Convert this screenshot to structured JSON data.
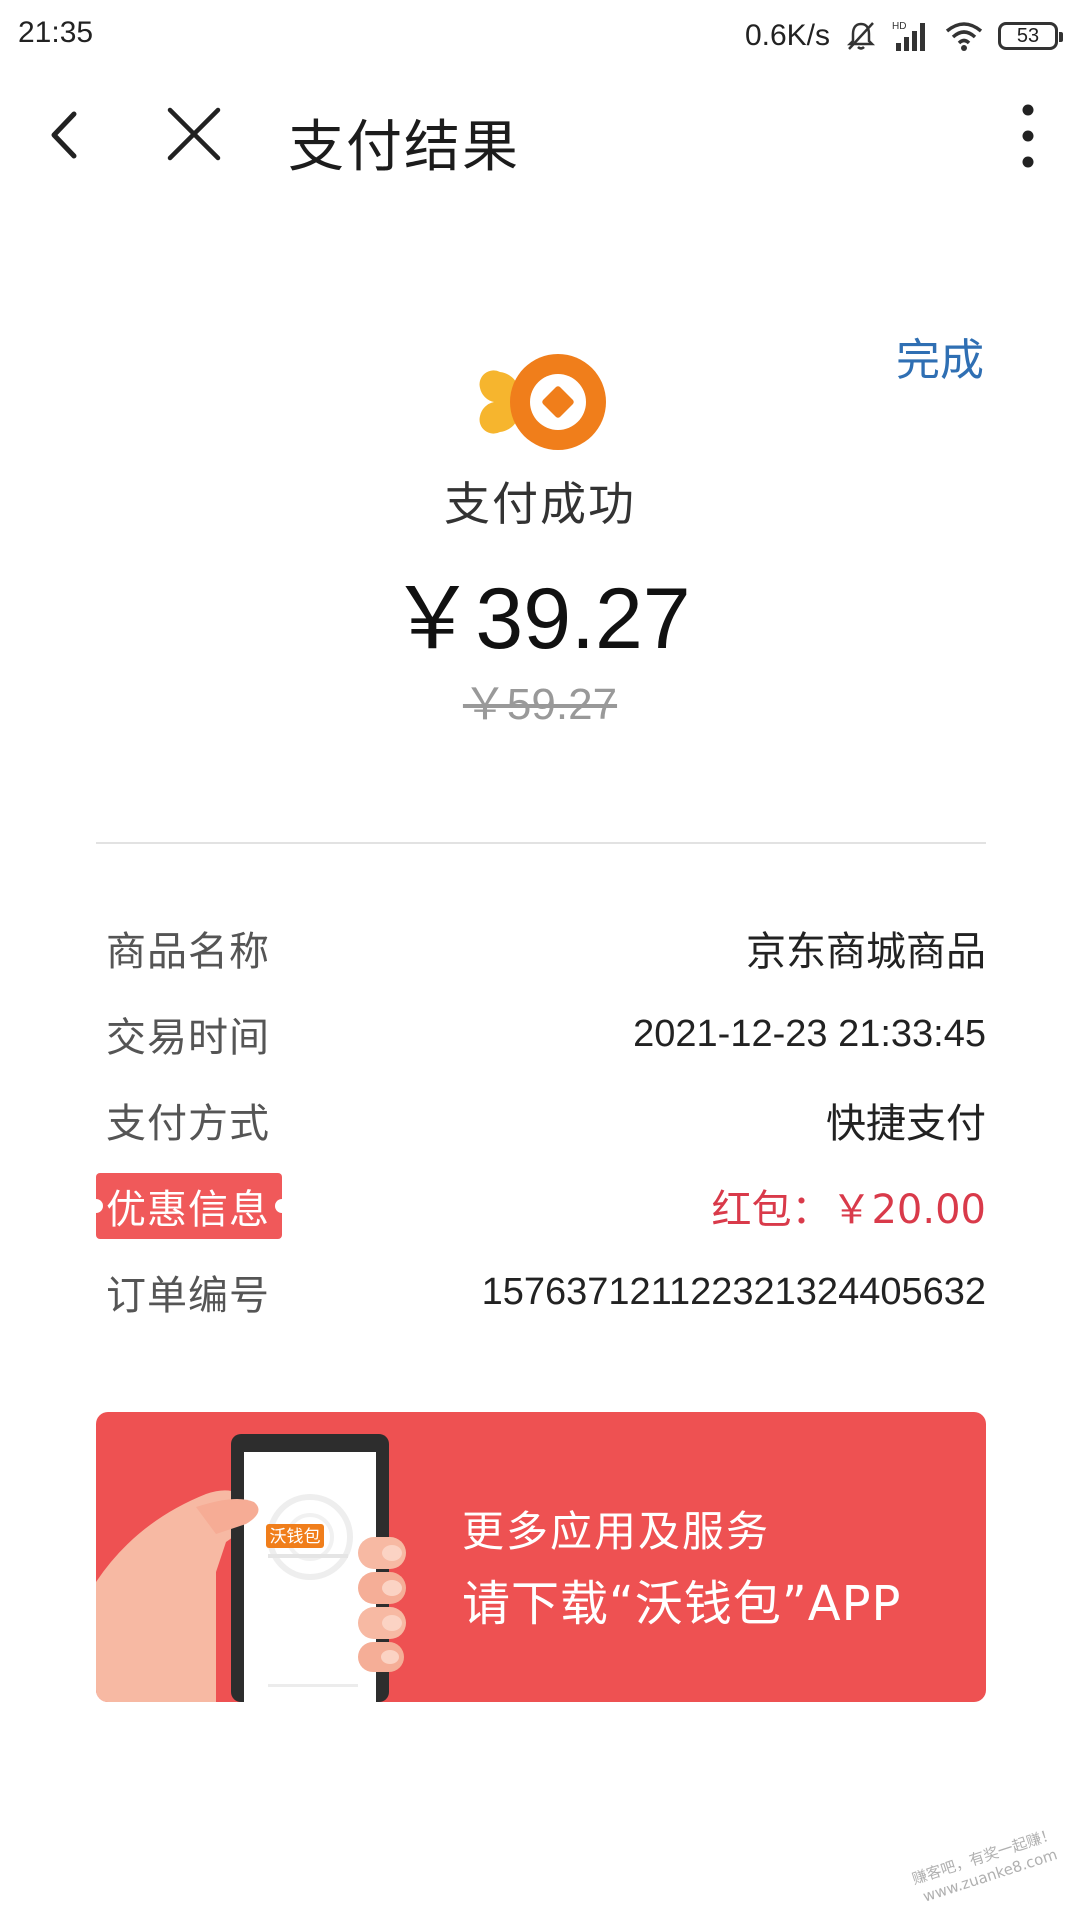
{
  "status_bar": {
    "time": "21:35",
    "net_speed": "0.6K/s",
    "battery": "53",
    "icons": [
      "mute-icon",
      "signal-icon",
      "wifi-icon",
      "battery-icon"
    ]
  },
  "nav": {
    "title": "支付结果",
    "icons": [
      "back-arrow-icon",
      "close-icon",
      "more-vertical-icon"
    ]
  },
  "result": {
    "done_label": "完成",
    "status": "支付成功",
    "amount_paid": "￥39.27",
    "amount_original": "￥59.27",
    "logo_icon": "wallet-logo-icon"
  },
  "details": {
    "product_label": "商品名称",
    "product_value": "京东商城商品",
    "time_label": "交易时间",
    "time_value": "2021-12-23 21:33:45",
    "method_label": "支付方式",
    "method_value": "快捷支付",
    "discount_label": "优惠信息",
    "discount_value": "红包：￥20.00",
    "order_label": "订单编号",
    "order_value": "1576371211223213244056 32"
  },
  "banner": {
    "line1": "更多应用及服务",
    "line2": "请下载“沃钱包”APP",
    "phone_logo_text": "沃钱包",
    "background_color": "#ee5152"
  },
  "watermark": {
    "line1": "赚客吧，有奖一起赚！",
    "line2": "www.zuanke8.com"
  },
  "colors": {
    "link": "#2f6fb3",
    "discount": "#d93a4a",
    "tag": "#f0595a"
  }
}
